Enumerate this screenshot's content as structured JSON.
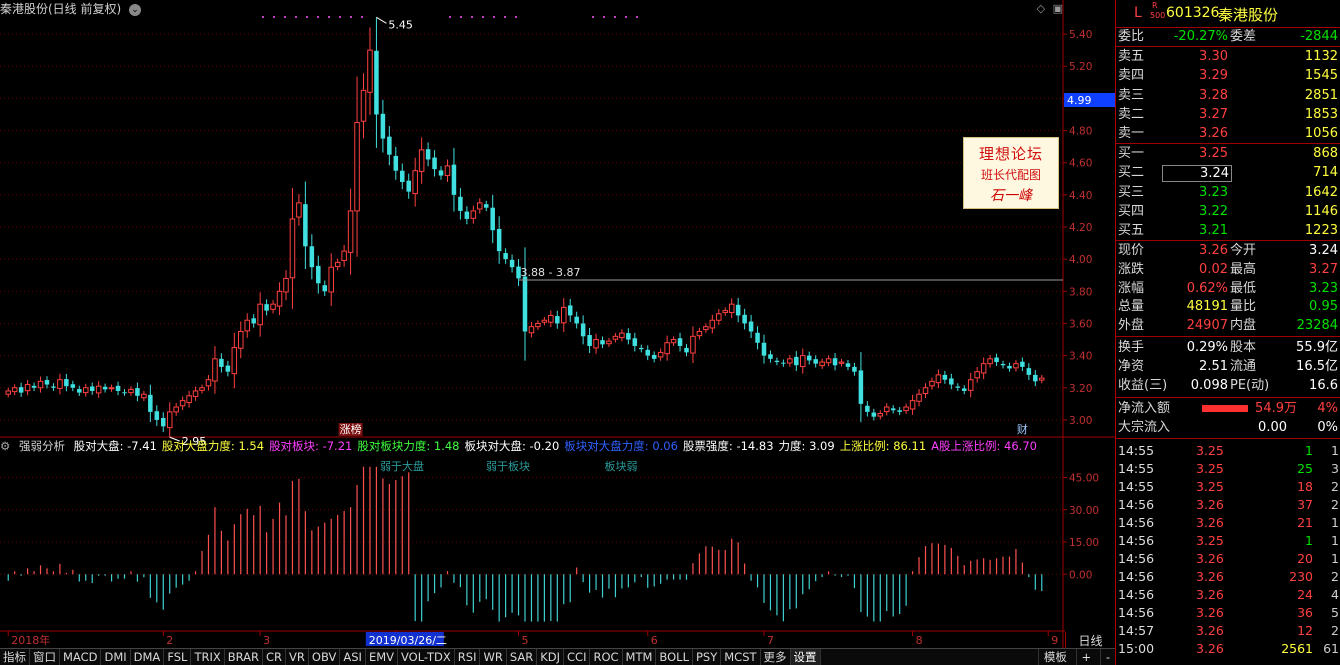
{
  "header": {
    "title": "秦港股份(日线 前复权)",
    "circle_icon": "⌄",
    "win_buttons": [
      "◇",
      "▣"
    ]
  },
  "chart_data": {
    "type": "candlestick",
    "ylim": [
      2.9,
      5.5
    ],
    "y_ticks": [
      3.0,
      3.2,
      3.4,
      3.6,
      3.8,
      4.0,
      4.2,
      4.4,
      4.6,
      4.8,
      5.0,
      5.2,
      5.4
    ],
    "y_tick_labels": [
      "3.00",
      "3.20",
      "3.40",
      "3.60",
      "3.80",
      "4.00",
      "4.20",
      "4.40",
      "4.60",
      "4.80",
      "5.00",
      "5.20",
      "5.40"
    ],
    "current_price_marker": "4.99",
    "high_annotation": "5.45",
    "low_annotation": "2.95",
    "resistance_line": {
      "value": 3.87,
      "label": "3.88 - 3.87"
    },
    "event_tags": [
      {
        "label": "涨榜",
        "index": 53
      },
      {
        "label": "财",
        "index": 157
      }
    ],
    "x_labels": [
      {
        "label": "2018年",
        "index": 0
      },
      {
        "label": "2",
        "index": 24
      },
      {
        "label": "3",
        "index": 39
      },
      {
        "label": "2019/03/26/二",
        "index": 60,
        "highlight": true
      },
      {
        "label": "5",
        "index": 79
      },
      {
        "label": "6",
        "index": 99
      },
      {
        "label": "7",
        "index": 117
      },
      {
        "label": "8",
        "index": 140
      },
      {
        "label": "9",
        "index": 161
      }
    ],
    "close": [
      3.18,
      3.2,
      3.17,
      3.22,
      3.2,
      3.24,
      3.22,
      3.2,
      3.25,
      3.21,
      3.2,
      3.17,
      3.2,
      3.18,
      3.21,
      3.19,
      3.2,
      3.18,
      3.17,
      3.19,
      3.15,
      3.16,
      3.05,
      3.0,
      2.96,
      3.05,
      3.08,
      3.12,
      3.15,
      3.18,
      3.2,
      3.25,
      3.38,
      3.33,
      3.3,
      3.45,
      3.55,
      3.62,
      3.6,
      3.72,
      3.68,
      3.72,
      3.8,
      3.88,
      4.25,
      4.35,
      4.08,
      3.95,
      3.85,
      3.8,
      3.95,
      3.98,
      4.05,
      4.3,
      4.85,
      5.05,
      5.3,
      4.9,
      4.75,
      4.65,
      4.55,
      4.48,
      4.42,
      4.55,
      4.68,
      4.62,
      4.56,
      4.52,
      4.58,
      4.4,
      4.3,
      4.25,
      4.3,
      4.35,
      4.32,
      4.18,
      4.05,
      4.0,
      3.95,
      3.88,
      3.55,
      3.58,
      3.6,
      3.62,
      3.65,
      3.6,
      3.7,
      3.65,
      3.6,
      3.52,
      3.46,
      3.5,
      3.47,
      3.49,
      3.52,
      3.54,
      3.5,
      3.46,
      3.44,
      3.4,
      3.38,
      3.42,
      3.48,
      3.5,
      3.46,
      3.42,
      3.52,
      3.55,
      3.58,
      3.62,
      3.66,
      3.68,
      3.72,
      3.65,
      3.6,
      3.55,
      3.48,
      3.4,
      3.38,
      3.36,
      3.35,
      3.38,
      3.34,
      3.4,
      3.37,
      3.35,
      3.36,
      3.38,
      3.34,
      3.36,
      3.33,
      3.3,
      3.1,
      3.05,
      3.02,
      3.04,
      3.08,
      3.06,
      3.05,
      3.08,
      3.12,
      3.16,
      3.2,
      3.24,
      3.28,
      3.25,
      3.22,
      3.2,
      3.18,
      3.25,
      3.3,
      3.35,
      3.38,
      3.36,
      3.34,
      3.32,
      3.35,
      3.33,
      3.28,
      3.24,
      3.26
    ],
    "indicator": {
      "ylim": [
        -25,
        55
      ],
      "y_ticks": [
        0,
        15,
        30,
        45
      ],
      "y_tick_labels": [
        "0.00",
        "15.00",
        "30.00",
        "45.00"
      ],
      "labels_in_chart": [
        "弱于大盘",
        "弱于板块",
        "板块弱"
      ]
    }
  },
  "indicator_header": {
    "name": "强弱分析",
    "items": [
      {
        "text": "股对大盘: -7.41",
        "color": "#ffffff"
      },
      {
        "text": "股对大盘力度: 1.54",
        "color": "#ffff40"
      },
      {
        "text": "股对板块: -7.21",
        "color": "#ff40ff"
      },
      {
        "text": "股对板块力度: 1.48",
        "color": "#40ff40"
      },
      {
        "text": "板块对大盘: -0.20",
        "color": "#ffffff"
      },
      {
        "text": "板块对大盘力度: 0.06",
        "color": "#3060ff"
      },
      {
        "text": "股票强度: -14.83",
        "color": "#ffffff"
      },
      {
        "text": "力度: 3.09",
        "color": "#ffffff"
      },
      {
        "text": "上涨比例: 86.11",
        "color": "#ffff40"
      },
      {
        "text": "A股上涨比例: 46.70",
        "color": "#ff40ff"
      }
    ]
  },
  "watermark": {
    "line1": "理想论坛",
    "line2": "班长代配图",
    "line3": "石一峰"
  },
  "toolbar": {
    "items": [
      "指标",
      "窗口",
      "MACD",
      "DMI",
      "DMA",
      "FSL",
      "TRIX",
      "BRAR",
      "CR",
      "VR",
      "OBV",
      "ASI",
      "EMV",
      "VOL-TDX",
      "RSI",
      "WR",
      "SAR",
      "KDJ",
      "CCI",
      "ROC",
      "MTM",
      "BOLL",
      "PSY",
      "MCST",
      "更多",
      "设置"
    ],
    "active": "设置",
    "right_items": [
      "模板",
      "+",
      "-"
    ],
    "period": "日线"
  },
  "panel": {
    "badge_l": "L",
    "badge_r": "R",
    "badge_500": "500",
    "code": "601326",
    "name": "秦港股份",
    "weibi_label": "委比",
    "weibi": "-20.27%",
    "weicha_label": "委差",
    "weicha": "-2844",
    "asks": [
      {
        "label": "卖五",
        "price": "3.30",
        "vol": "1132"
      },
      {
        "label": "卖四",
        "price": "3.29",
        "vol": "1545"
      },
      {
        "label": "卖三",
        "price": "3.28",
        "vol": "2851"
      },
      {
        "label": "卖二",
        "price": "3.27",
        "vol": "1853"
      },
      {
        "label": "卖一",
        "price": "3.26",
        "vol": "1056"
      }
    ],
    "bids": [
      {
        "label": "买一",
        "price": "3.25",
        "vol": "868"
      },
      {
        "label": "买二",
        "price": "3.24",
        "vol": "714"
      },
      {
        "label": "买三",
        "price": "3.23",
        "vol": "1642"
      },
      {
        "label": "买四",
        "price": "3.22",
        "vol": "1146"
      },
      {
        "label": "买五",
        "price": "3.21",
        "vol": "1223"
      }
    ],
    "stats": [
      {
        "l1": "现价",
        "v1": "3.26",
        "c1": "red",
        "l2": "今开",
        "v2": "3.24",
        "c2": "white"
      },
      {
        "l1": "涨跌",
        "v1": "0.02",
        "c1": "red",
        "l2": "最高",
        "v2": "3.27",
        "c2": "red"
      },
      {
        "l1": "涨幅",
        "v1": "0.62%",
        "c1": "red",
        "l2": "最低",
        "v2": "3.23",
        "c2": "green"
      },
      {
        "l1": "总量",
        "v1": "48191",
        "c1": "yellow",
        "l2": "量比",
        "v2": "0.95",
        "c2": "green"
      },
      {
        "l1": "外盘",
        "v1": "24907",
        "c1": "red",
        "l2": "内盘",
        "v2": "23284",
        "c2": "green"
      }
    ],
    "stats2": [
      {
        "l1": "换手",
        "v1": "0.29%",
        "l2": "股本",
        "v2": "55.9亿"
      },
      {
        "l1": "净资",
        "v1": "2.51",
        "l2": "流通",
        "v2": "16.5亿"
      },
      {
        "l1": "收益(三)",
        "v1": "0.098",
        "l2": "PE(动)",
        "v2": "16.6"
      }
    ],
    "netflow_label": "净流入额",
    "netflow": "54.9万",
    "netflow_pct": "4%",
    "block_label": "大宗流入",
    "block": "0.00",
    "block_pct": "0%",
    "ticks": [
      {
        "t": "14:55",
        "p": "3.25",
        "v": "1",
        "vc": "green",
        "n": "1"
      },
      {
        "t": "14:55",
        "p": "3.25",
        "v": "25",
        "vc": "green",
        "n": "3"
      },
      {
        "t": "14:55",
        "p": "3.25",
        "v": "18",
        "vc": "red",
        "n": "2"
      },
      {
        "t": "14:56",
        "p": "3.26",
        "v": "37",
        "vc": "red",
        "n": "2"
      },
      {
        "t": "14:56",
        "p": "3.26",
        "v": "21",
        "vc": "red",
        "n": "1"
      },
      {
        "t": "14:56",
        "p": "3.25",
        "v": "1",
        "vc": "green",
        "n": "1"
      },
      {
        "t": "14:56",
        "p": "3.26",
        "v": "20",
        "vc": "red",
        "n": "1"
      },
      {
        "t": "14:56",
        "p": "3.26",
        "v": "230",
        "vc": "red",
        "n": "2"
      },
      {
        "t": "14:56",
        "p": "3.26",
        "v": "24",
        "vc": "red",
        "n": "4"
      },
      {
        "t": "14:56",
        "p": "3.26",
        "v": "36",
        "vc": "red",
        "n": "5"
      },
      {
        "t": "14:57",
        "p": "3.26",
        "v": "12",
        "vc": "red",
        "n": "2"
      },
      {
        "t": "15:00",
        "p": "3.26",
        "v": "2561",
        "vc": "yellow",
        "n": "61"
      }
    ]
  },
  "colors": {
    "up": "#ff4040",
    "down": "#40e0e0",
    "grid": "#600000",
    "axis": "#a00000"
  }
}
